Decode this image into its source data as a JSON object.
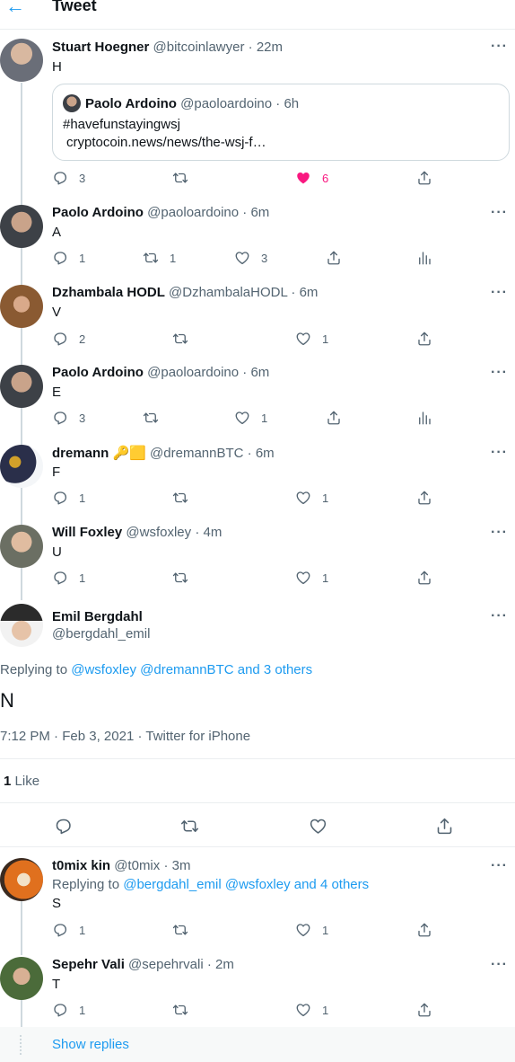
{
  "header": {
    "back_icon": "←",
    "title": "Tweet"
  },
  "icons": {
    "more": "···"
  },
  "tweets": [
    {
      "name": "Stuart Hoegner",
      "handle": "@bitcoinlawyer",
      "time": "22m",
      "text": "H",
      "quote": {
        "name": "Paolo Ardoino",
        "handle": "@paoloardoino",
        "time": "6h",
        "line1": "#havefunstayingwsj",
        "line2": "cryptocoin.news/news/the-wsj-f…"
      },
      "replies": "3",
      "retweets": "",
      "likes": "6"
    },
    {
      "name": "Paolo Ardoino",
      "handle": "@paoloardoino",
      "time": "6m",
      "text": "A",
      "replies": "1",
      "retweets": "1",
      "likes": "3"
    },
    {
      "name": "Dzhambala HODL",
      "handle": "@DzhambalaHODL",
      "time": "6m",
      "text": "V",
      "replies": "2",
      "retweets": "",
      "likes": "1"
    },
    {
      "name": "Paolo Ardoino",
      "handle": "@paoloardoino",
      "time": "6m",
      "text": "E",
      "replies": "3",
      "retweets": "",
      "likes": "1"
    },
    {
      "name": "dremann 🔑🟨",
      "handle": "@dremannBTC",
      "time": "6m",
      "text": "F",
      "replies": "1",
      "retweets": "",
      "likes": "1"
    },
    {
      "name": "Will Foxley",
      "handle": "@wsfoxley",
      "time": "4m",
      "text": "U",
      "replies": "1",
      "retweets": "",
      "likes": "1"
    }
  ],
  "main": {
    "name": "Emil Bergdahl",
    "handle": "@bergdahl_emil",
    "replying_prefix": "Replying to",
    "replying_links": "@wsfoxley @dremannBTC and 3 others",
    "text": "N",
    "time": "7:12 PM",
    "date": "Feb 3, 2021",
    "source": "Twitter for iPhone",
    "likes_count": "1",
    "likes_label": "Like"
  },
  "replies": [
    {
      "name": "t0mix kin",
      "handle": "@t0mix",
      "time": "3m",
      "replying_prefix": "Replying to",
      "replying_links": "@bergdahl_emil @wsfoxley and 4 others",
      "text": "S",
      "replies": "1",
      "retweets": "",
      "likes": "1"
    },
    {
      "name": "Sepehr Vali",
      "handle": "@sepehrvali",
      "time": "2m",
      "text": "T",
      "replies": "1",
      "retweets": "",
      "likes": "1"
    }
  ],
  "show_replies": "Show replies",
  "colors": {
    "accent": "#1d9bf0",
    "like": "#f91880",
    "muted": "#536471",
    "border": "#cfd9de"
  }
}
